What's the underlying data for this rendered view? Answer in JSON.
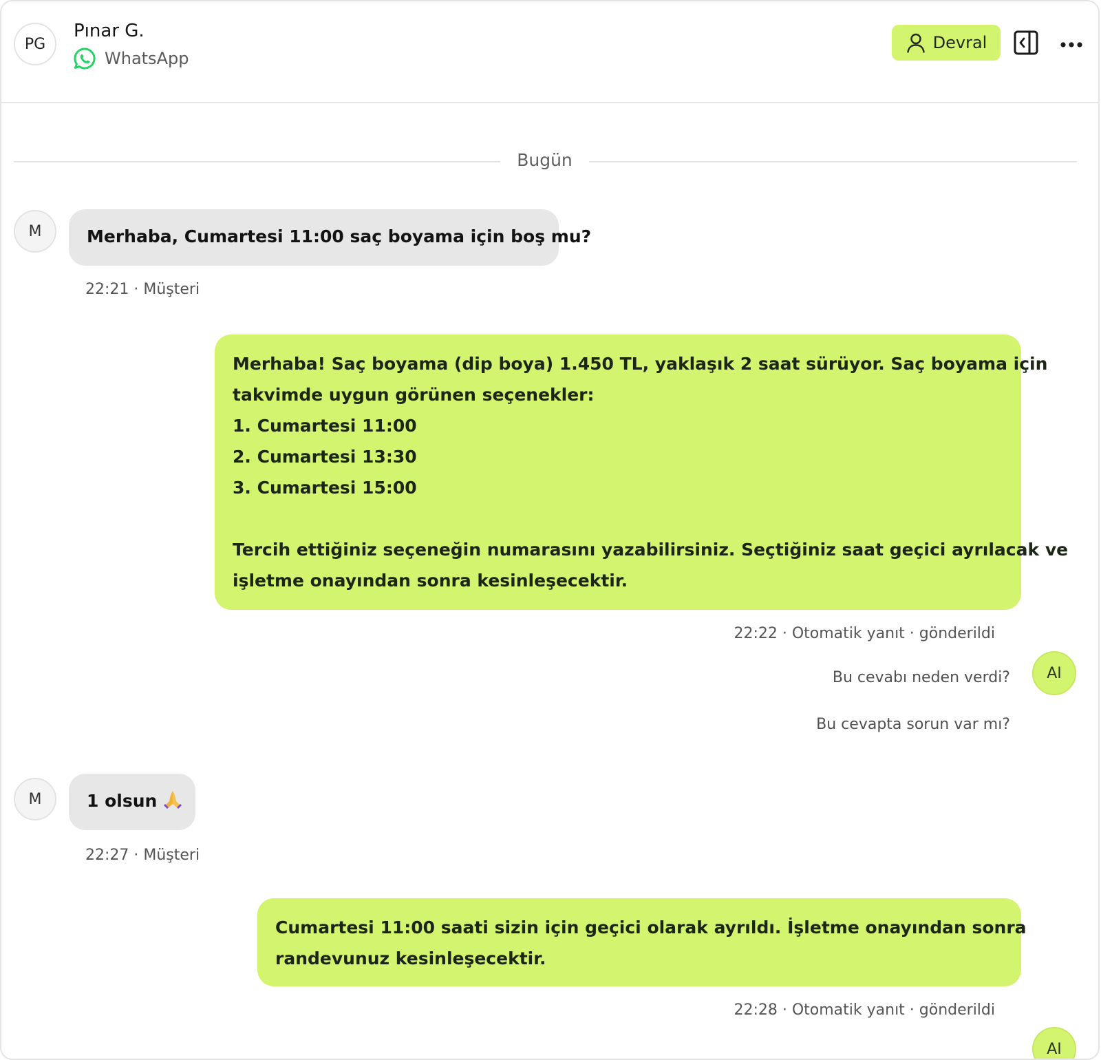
{
  "header": {
    "avatar_initials": "PG",
    "contact_name": "Pınar G.",
    "channel": "WhatsApp",
    "takeover_label": "Devral",
    "channel_icon": "whatsapp-icon",
    "accent_color": "#d3f46f",
    "whatsapp_color": "#25d366"
  },
  "chat": {
    "date_divider": "Bugün",
    "messages": [
      {
        "direction": "incoming",
        "avatar": "M",
        "text": "Merhaba, Cumartesi 11:00 saç boyama için boş mu?",
        "meta": "22:21 · Müşteri"
      },
      {
        "direction": "outgoing",
        "lines": [
          "Merhaba! Saç boyama (dip boya) 1.450 TL, yaklaşık 2 saat sürüyor. Saç boyama için",
          "takvimde uygun görünen seçenekler:",
          "1. Cumartesi 11:00",
          "2. Cumartesi 13:30",
          "3. Cumartesi 15:00",
          "",
          "Tercih ettiğiniz seçeneğin numarasını yazabilirsiniz. Seçtiğiniz saat geçici ayrılacak ve",
          "işletme onayından sonra kesinleşecektir."
        ],
        "meta": "22:22 · Otomatik yanıt · gönderildi",
        "ai_avatar": "AI",
        "why_link": "Bu cevabı neden verdi?",
        "issue_link": "Bu cevapta sorun var mı?"
      },
      {
        "direction": "incoming",
        "avatar": "M",
        "text": "1 olsun",
        "emoji_icon": "folded-hands-emoji",
        "meta": "22:27 · Müşteri"
      },
      {
        "direction": "outgoing",
        "lines": [
          "Cumartesi 11:00 saati sizin için geçici olarak ayrıldı. İşletme onayından sonra",
          "randevunuz kesinleşecektir."
        ],
        "meta": "22:28 · Otomatik yanıt · gönderildi",
        "ai_avatar": "AI"
      }
    ]
  }
}
